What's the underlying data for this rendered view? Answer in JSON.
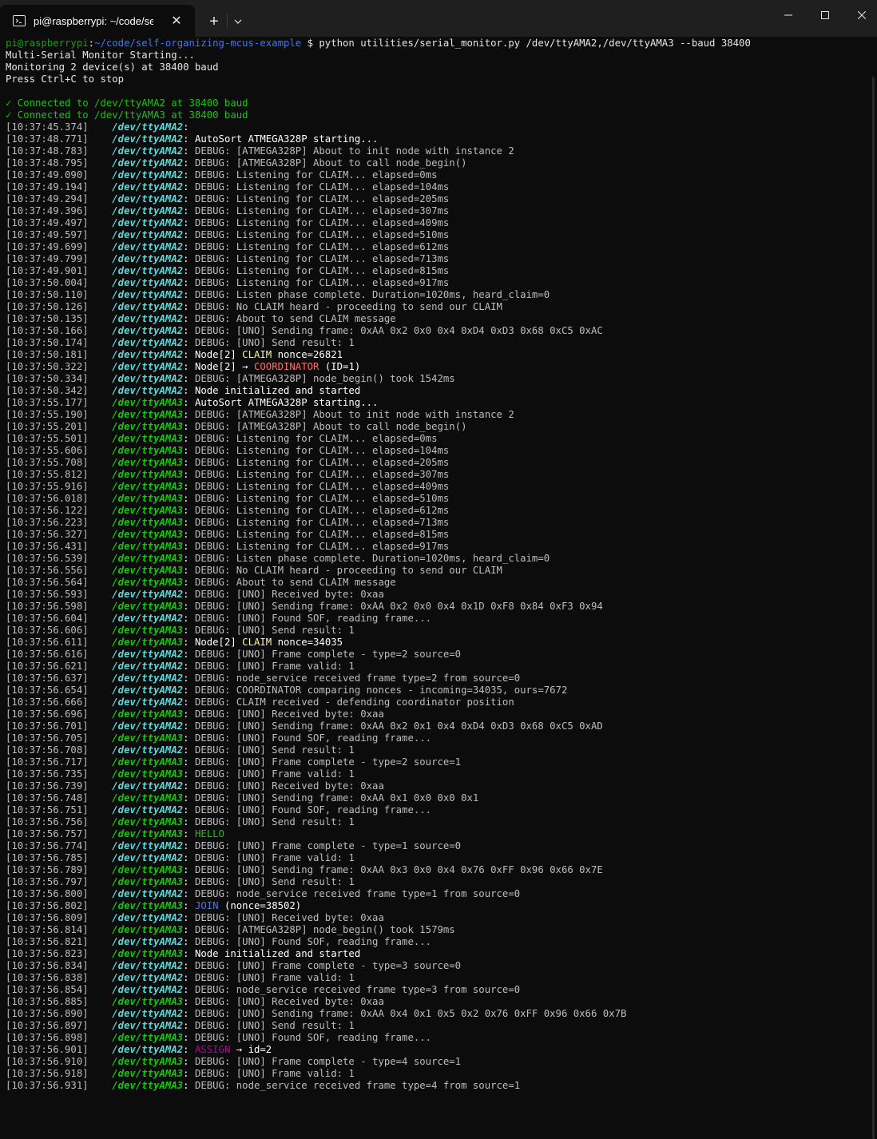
{
  "window": {
    "tab_title": "pi@raspberrypi: ~/code/self-organizing-mcus-example",
    "close_tab_glyph": "✕",
    "new_tab_glyph": "+",
    "icons": [
      "terminal-icon",
      "close-icon",
      "plus-icon",
      "chevron-down-icon",
      "minimize-icon",
      "maximize-icon",
      "close-window-icon"
    ]
  },
  "terminal": {
    "prompt_user": "pi@raspberrypi",
    "prompt_sep": ":",
    "prompt_path": "~/code/self-organizing-mcus-example",
    "prompt_symbol": " $ ",
    "command": "python utilities/serial_monitor.py /dev/ttyAMA2,/dev/ttyAMA3 --baud 38400",
    "header": [
      "Multi-Serial Monitor Starting...",
      "Monitoring 2 device(s) at 38400 baud",
      "Press Ctrl+C to stop",
      ""
    ],
    "connected": [
      "✓ Connected to /dev/ttyAMA2 at 38400 baud",
      "✓ Connected to /dev/ttyAMA3 at 38400 baud"
    ],
    "colors": {
      "background": "#0c0c0c",
      "ttyAMA2": "#61d6d6",
      "ttyAMA3": "#16c60c",
      "claim": "#f9f1a5",
      "coordinator": "#ff6b6b",
      "join": "#3b78ff",
      "assign": "#b4009e"
    },
    "log": [
      [
        "10:37:45.374",
        "2",
        "",
        ""
      ],
      [
        "10:37:48.771",
        "2",
        "AutoSort ATMEGA328P starting...",
        "msg"
      ],
      [
        "10:37:48.783",
        "2",
        "DEBUG: [ATMEGA328P] About to init node with instance 2",
        "dbg"
      ],
      [
        "10:37:48.795",
        "2",
        "DEBUG: [ATMEGA328P] About to call node_begin()",
        "dbg"
      ],
      [
        "10:37:49.090",
        "2",
        "DEBUG: Listening for CLAIM... elapsed=0ms",
        "dbg"
      ],
      [
        "10:37:49.194",
        "2",
        "DEBUG: Listening for CLAIM... elapsed=104ms",
        "dbg"
      ],
      [
        "10:37:49.294",
        "2",
        "DEBUG: Listening for CLAIM... elapsed=205ms",
        "dbg"
      ],
      [
        "10:37:49.396",
        "2",
        "DEBUG: Listening for CLAIM... elapsed=307ms",
        "dbg"
      ],
      [
        "10:37:49.497",
        "2",
        "DEBUG: Listening for CLAIM... elapsed=409ms",
        "dbg"
      ],
      [
        "10:37:49.597",
        "2",
        "DEBUG: Listening for CLAIM... elapsed=510ms",
        "dbg"
      ],
      [
        "10:37:49.699",
        "2",
        "DEBUG: Listening for CLAIM... elapsed=612ms",
        "dbg"
      ],
      [
        "10:37:49.799",
        "2",
        "DEBUG: Listening for CLAIM... elapsed=713ms",
        "dbg"
      ],
      [
        "10:37:49.901",
        "2",
        "DEBUG: Listening for CLAIM... elapsed=815ms",
        "dbg"
      ],
      [
        "10:37:50.004",
        "2",
        "DEBUG: Listening for CLAIM... elapsed=917ms",
        "dbg"
      ],
      [
        "10:37:50.110",
        "2",
        "DEBUG: Listen phase complete. Duration=1020ms, heard_claim=0",
        "dbg"
      ],
      [
        "10:37:50.126",
        "2",
        "DEBUG: No CLAIM heard - proceeding to send our CLAIM",
        "dbg"
      ],
      [
        "10:37:50.135",
        "2",
        "DEBUG: About to send CLAIM message",
        "dbg"
      ],
      [
        "10:37:50.166",
        "2",
        "DEBUG: [UNO] Sending frame: 0xAA 0x2 0x0 0x4 0xD4 0xD3 0x68 0xC5 0xAC",
        "dbg"
      ],
      [
        "10:37:50.174",
        "2",
        "DEBUG: [UNO] Send result: 1",
        "dbg"
      ],
      [
        "10:37:50.181",
        "2",
        "Node[2] |CLAIM| nonce=26821",
        "claim"
      ],
      [
        "10:37:50.322",
        "2",
        "Node[2] → |COORDINATOR| (ID=1)",
        "coord"
      ],
      [
        "10:37:50.334",
        "2",
        "DEBUG: [ATMEGA328P] node_begin() took 1542ms",
        "dbg"
      ],
      [
        "10:37:50.342",
        "2",
        "Node initialized and started",
        "msg"
      ],
      [
        "10:37:55.177",
        "3",
        "AutoSort ATMEGA328P starting...",
        "msg"
      ],
      [
        "10:37:55.190",
        "3",
        "DEBUG: [ATMEGA328P] About to init node with instance 2",
        "dbg"
      ],
      [
        "10:37:55.201",
        "3",
        "DEBUG: [ATMEGA328P] About to call node_begin()",
        "dbg"
      ],
      [
        "10:37:55.501",
        "3",
        "DEBUG: Listening for CLAIM... elapsed=0ms",
        "dbg"
      ],
      [
        "10:37:55.606",
        "3",
        "DEBUG: Listening for CLAIM... elapsed=104ms",
        "dbg"
      ],
      [
        "10:37:55.708",
        "3",
        "DEBUG: Listening for CLAIM... elapsed=205ms",
        "dbg"
      ],
      [
        "10:37:55.812",
        "3",
        "DEBUG: Listening for CLAIM... elapsed=307ms",
        "dbg"
      ],
      [
        "10:37:55.916",
        "3",
        "DEBUG: Listening for CLAIM... elapsed=409ms",
        "dbg"
      ],
      [
        "10:37:56.018",
        "3",
        "DEBUG: Listening for CLAIM... elapsed=510ms",
        "dbg"
      ],
      [
        "10:37:56.122",
        "3",
        "DEBUG: Listening for CLAIM... elapsed=612ms",
        "dbg"
      ],
      [
        "10:37:56.223",
        "3",
        "DEBUG: Listening for CLAIM... elapsed=713ms",
        "dbg"
      ],
      [
        "10:37:56.327",
        "3",
        "DEBUG: Listening for CLAIM... elapsed=815ms",
        "dbg"
      ],
      [
        "10:37:56.431",
        "3",
        "DEBUG: Listening for CLAIM... elapsed=917ms",
        "dbg"
      ],
      [
        "10:37:56.539",
        "3",
        "DEBUG: Listen phase complete. Duration=1020ms, heard_claim=0",
        "dbg"
      ],
      [
        "10:37:56.556",
        "3",
        "DEBUG: No CLAIM heard - proceeding to send our CLAIM",
        "dbg"
      ],
      [
        "10:37:56.564",
        "3",
        "DEBUG: About to send CLAIM message",
        "dbg"
      ],
      [
        "10:37:56.593",
        "2",
        "DEBUG: [UNO] Received byte: 0xaa",
        "dbg"
      ],
      [
        "10:37:56.598",
        "3",
        "DEBUG: [UNO] Sending frame: 0xAA 0x2 0x0 0x4 0x1D 0xF8 0x84 0xF3 0x94",
        "dbg"
      ],
      [
        "10:37:56.604",
        "2",
        "DEBUG: [UNO] Found SOF, reading frame...",
        "dbg"
      ],
      [
        "10:37:56.606",
        "3",
        "DEBUG: [UNO] Send result: 1",
        "dbg"
      ],
      [
        "10:37:56.611",
        "3",
        "Node[2] |CLAIM| nonce=34035",
        "claim"
      ],
      [
        "10:37:56.616",
        "2",
        "DEBUG: [UNO] Frame complete - type=2 source=0",
        "dbg"
      ],
      [
        "10:37:56.621",
        "2",
        "DEBUG: [UNO] Frame valid: 1",
        "dbg"
      ],
      [
        "10:37:56.637",
        "2",
        "DEBUG: node_service received frame type=2 from source=0",
        "dbg"
      ],
      [
        "10:37:56.654",
        "2",
        "DEBUG: COORDINATOR comparing nonces - incoming=34035, ours=7672",
        "dbg"
      ],
      [
        "10:37:56.666",
        "2",
        "DEBUG: CLAIM received - defending coordinator position",
        "dbg"
      ],
      [
        "10:37:56.696",
        "3",
        "DEBUG: [UNO] Received byte: 0xaa",
        "dbg"
      ],
      [
        "10:37:56.701",
        "2",
        "DEBUG: [UNO] Sending frame: 0xAA 0x2 0x1 0x4 0xD4 0xD3 0x68 0xC5 0xAD",
        "dbg"
      ],
      [
        "10:37:56.705",
        "3",
        "DEBUG: [UNO] Found SOF, reading frame...",
        "dbg"
      ],
      [
        "10:37:56.708",
        "2",
        "DEBUG: [UNO] Send result: 1",
        "dbg"
      ],
      [
        "10:37:56.717",
        "3",
        "DEBUG: [UNO] Frame complete - type=2 source=1",
        "dbg"
      ],
      [
        "10:37:56.735",
        "3",
        "DEBUG: [UNO] Frame valid: 1",
        "dbg"
      ],
      [
        "10:37:56.739",
        "2",
        "DEBUG: [UNO] Received byte: 0xaa",
        "dbg"
      ],
      [
        "10:37:56.748",
        "3",
        "DEBUG: [UNO] Sending frame: 0xAA 0x1 0x0 0x0 0x1",
        "dbg"
      ],
      [
        "10:37:56.751",
        "2",
        "DEBUG: [UNO] Found SOF, reading frame...",
        "dbg"
      ],
      [
        "10:37:56.756",
        "3",
        "DEBUG: [UNO] Send result: 1",
        "dbg"
      ],
      [
        "10:37:56.757",
        "3",
        "|HELLO|",
        "hello"
      ],
      [
        "10:37:56.774",
        "2",
        "DEBUG: [UNO] Frame complete - type=1 source=0",
        "dbg"
      ],
      [
        "10:37:56.785",
        "2",
        "DEBUG: [UNO] Frame valid: 1",
        "dbg"
      ],
      [
        "10:37:56.789",
        "3",
        "DEBUG: [UNO] Sending frame: 0xAA 0x3 0x0 0x4 0x76 0xFF 0x96 0x66 0x7E",
        "dbg"
      ],
      [
        "10:37:56.797",
        "3",
        "DEBUG: [UNO] Send result: 1",
        "dbg"
      ],
      [
        "10:37:56.800",
        "2",
        "DEBUG: node_service received frame type=1 from source=0",
        "dbg"
      ],
      [
        "10:37:56.802",
        "3",
        "|JOIN| (nonce=38502)",
        "join"
      ],
      [
        "10:37:56.809",
        "2",
        "DEBUG: [UNO] Received byte: 0xaa",
        "dbg"
      ],
      [
        "10:37:56.814",
        "3",
        "DEBUG: [ATMEGA328P] node_begin() took 1579ms",
        "dbg"
      ],
      [
        "10:37:56.821",
        "2",
        "DEBUG: [UNO] Found SOF, reading frame...",
        "dbg"
      ],
      [
        "10:37:56.823",
        "3",
        "Node initialized and started",
        "msg"
      ],
      [
        "10:37:56.834",
        "2",
        "DEBUG: [UNO] Frame complete - type=3 source=0",
        "dbg"
      ],
      [
        "10:37:56.838",
        "2",
        "DEBUG: [UNO] Frame valid: 1",
        "dbg"
      ],
      [
        "10:37:56.854",
        "2",
        "DEBUG: node_service received frame type=3 from source=0",
        "dbg"
      ],
      [
        "10:37:56.885",
        "3",
        "DEBUG: [UNO] Received byte: 0xaa",
        "dbg"
      ],
      [
        "10:37:56.890",
        "2",
        "DEBUG: [UNO] Sending frame: 0xAA 0x4 0x1 0x5 0x2 0x76 0xFF 0x96 0x66 0x7B",
        "dbg"
      ],
      [
        "10:37:56.897",
        "2",
        "DEBUG: [UNO] Send result: 1",
        "dbg"
      ],
      [
        "10:37:56.898",
        "3",
        "DEBUG: [UNO] Found SOF, reading frame...",
        "dbg"
      ],
      [
        "10:37:56.901",
        "2",
        "|ASSIGN| → id=2",
        "assign"
      ],
      [
        "10:37:56.910",
        "3",
        "DEBUG: [UNO] Frame complete - type=4 source=1",
        "dbg"
      ],
      [
        "10:37:56.918",
        "3",
        "DEBUG: [UNO] Frame valid: 1",
        "dbg"
      ],
      [
        "10:37:56.931",
        "3",
        "DEBUG: node_service received frame type=4 from source=1",
        "dbg"
      ]
    ]
  }
}
